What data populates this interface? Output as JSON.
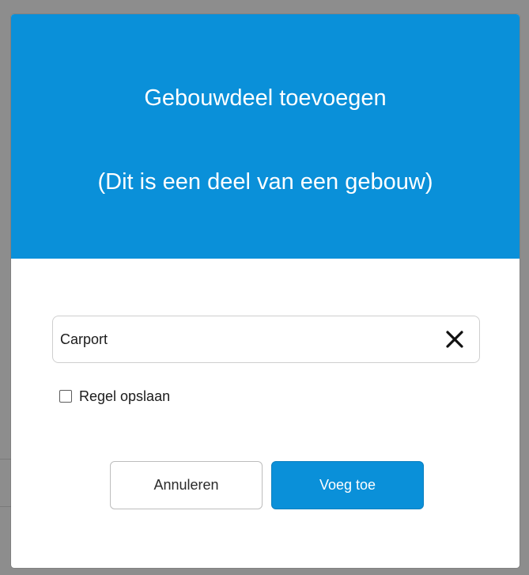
{
  "dialog": {
    "title": "Gebouwdeel toevoegen",
    "subtitle": "(Dit is een deel van een gebouw)",
    "input_value": "Carport",
    "checkbox_label": "Regel opslaan",
    "checkbox_checked": false,
    "cancel_label": "Annuleren",
    "add_label": "Voeg toe",
    "clear_icon": "close-icon"
  },
  "colors": {
    "accent": "#0a90d9",
    "backdrop": "#8d8d8d"
  }
}
